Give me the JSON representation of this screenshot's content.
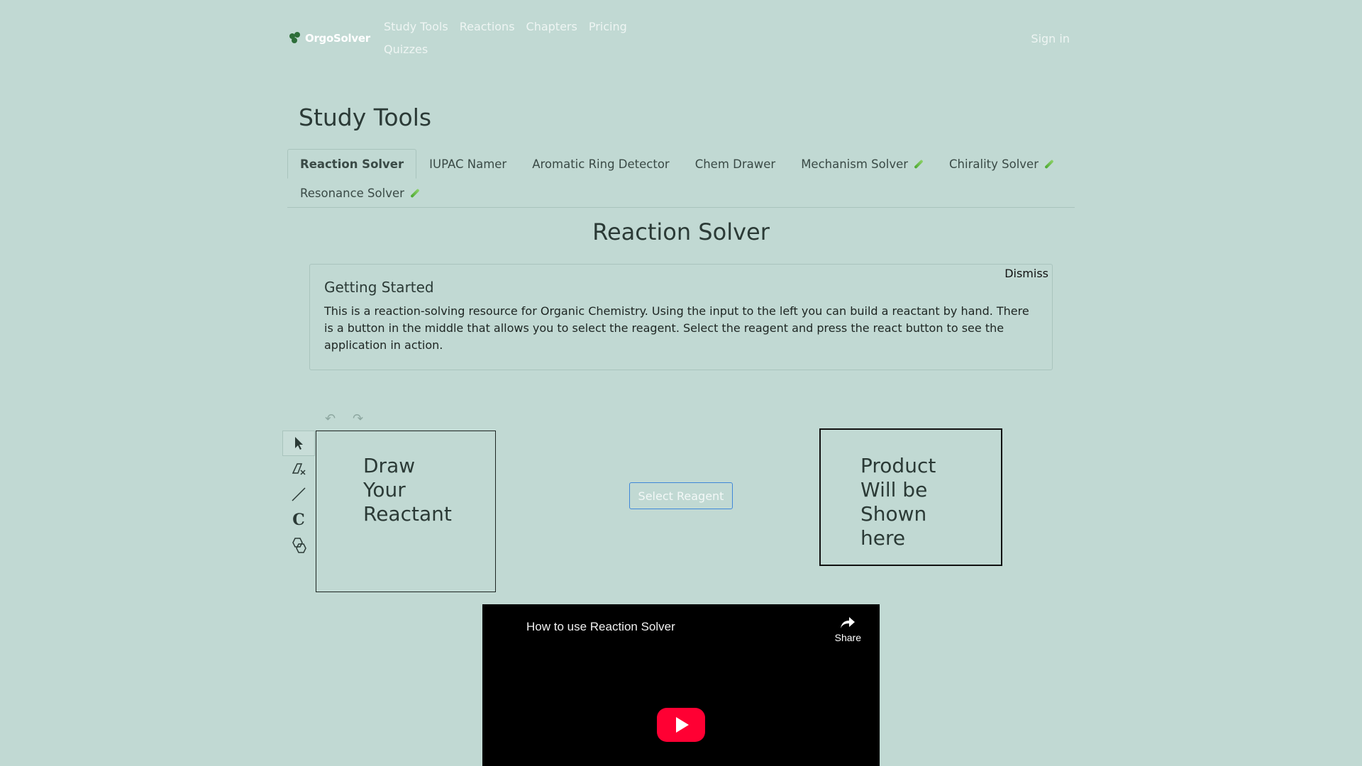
{
  "nav": {
    "brand": "OrgoSolver",
    "links": [
      "Study Tools",
      "Reactions",
      "Chapters",
      "Pricing",
      "Quizzes"
    ],
    "signin": "Sign in"
  },
  "page_title": "Study Tools",
  "tabs": [
    {
      "label": "Reaction Solver",
      "active": true,
      "beta_icon": false
    },
    {
      "label": "IUPAC Namer",
      "active": false,
      "beta_icon": false
    },
    {
      "label": "Aromatic Ring Detector",
      "active": false,
      "beta_icon": false
    },
    {
      "label": "Chem Drawer",
      "active": false,
      "beta_icon": false
    },
    {
      "label": "Mechanism Solver",
      "active": false,
      "beta_icon": true
    },
    {
      "label": "Chirality Solver",
      "active": false,
      "beta_icon": true
    },
    {
      "label": "Resonance Solver",
      "active": false,
      "beta_icon": true
    }
  ],
  "section_title": "Reaction Solver",
  "getting_started": {
    "title": "Getting Started",
    "body": "This is a reaction-solving resource for Organic Chemistry. Using the input to the left you can build a reactant by hand. There is a button in the middle that allows you to select the reagent. Select the reagent and press the react button to see the application in action.",
    "dismiss": "Dismiss"
  },
  "editor": {
    "tools": [
      "pointer-icon",
      "eraser-icon",
      "bond-icon",
      "carbon-icon",
      "ring-template-icon"
    ],
    "draw_placeholder": [
      "Draw",
      "Your",
      "Reactant"
    ]
  },
  "reagent_button": "Select Reagent",
  "product_placeholder": [
    "Product",
    "Will be",
    "Shown",
    "here"
  ],
  "video": {
    "title": "How to use Reaction Solver",
    "share": "Share"
  },
  "colors": {
    "background": "#c1d9d3",
    "button_border": "#3f87d8",
    "play_button": "#ff0033"
  }
}
